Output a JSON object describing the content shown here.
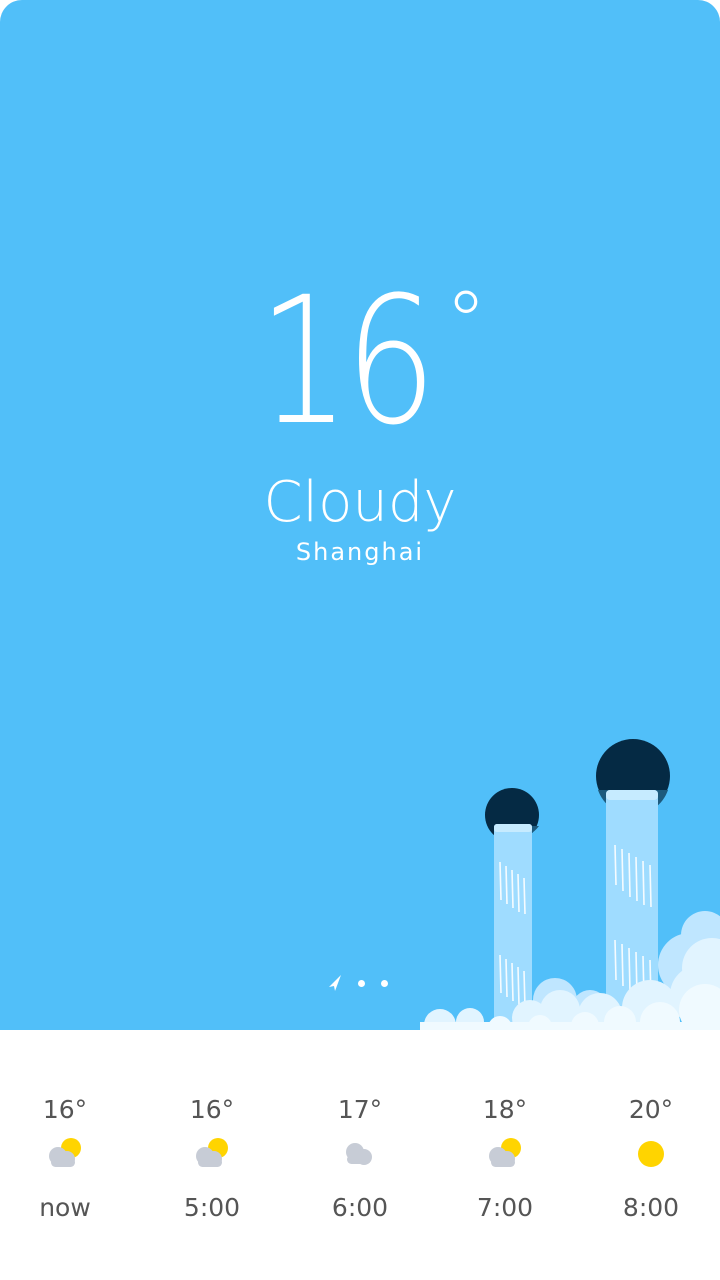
{
  "current": {
    "temperature": "16",
    "degree_symbol": "°",
    "condition": "Cloudy",
    "city": "Shanghai"
  },
  "pager": {
    "page_count": 3,
    "active": "location"
  },
  "colors": {
    "sky": "#51bff9",
    "forecast_bg": "#ffffff",
    "text_dark": "#555555",
    "sun": "#ffd400",
    "cloud": "#c7ccd6"
  },
  "hourly": [
    {
      "temp": "16°",
      "icon": "partly-cloudy-icon",
      "time": "now"
    },
    {
      "temp": "16°",
      "icon": "partly-cloudy-icon",
      "time": "5:00"
    },
    {
      "temp": "17°",
      "icon": "cloud-icon",
      "time": "6:00"
    },
    {
      "temp": "18°",
      "icon": "partly-cloudy-icon",
      "time": "7:00"
    },
    {
      "temp": "20°",
      "icon": "sun-icon",
      "time": "8:00"
    }
  ]
}
